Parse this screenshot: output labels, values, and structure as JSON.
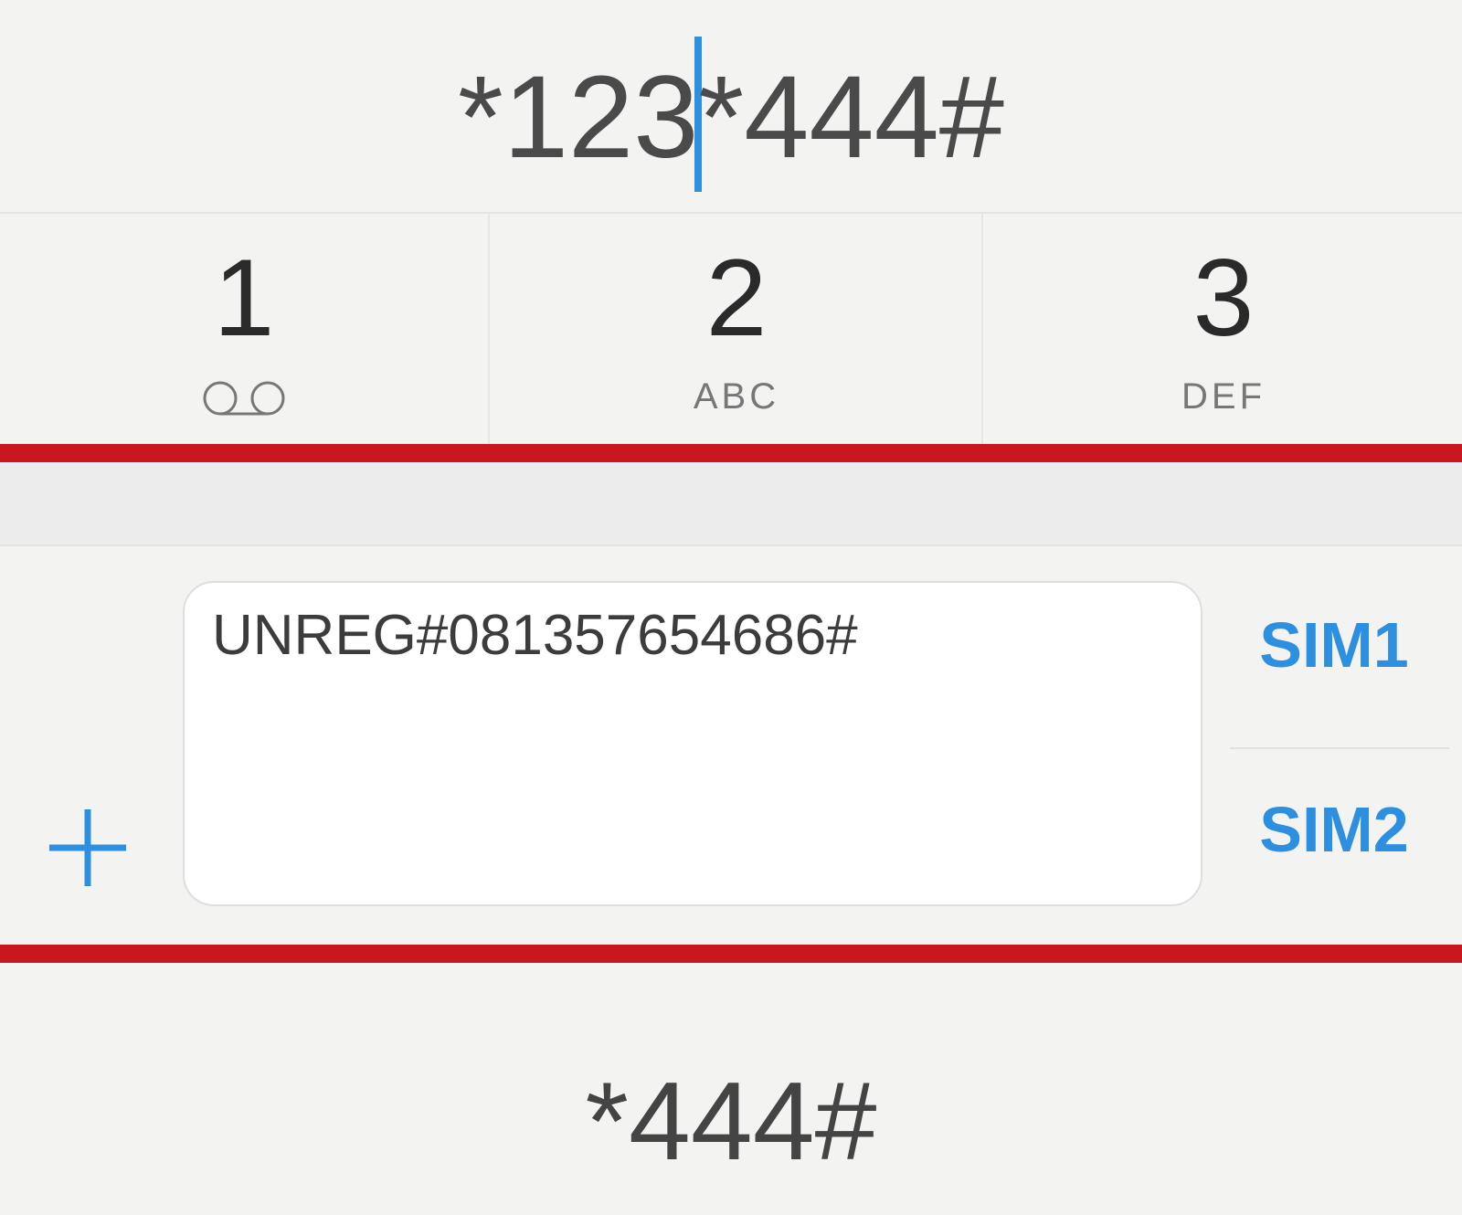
{
  "dialer": {
    "number_before_cursor": "*123",
    "number_after_cursor": "*444#"
  },
  "keypad": [
    {
      "digit": "1",
      "letters": "",
      "icon": "voicemail-icon"
    },
    {
      "digit": "2",
      "letters": "ABC"
    },
    {
      "digit": "3",
      "letters": "DEF"
    }
  ],
  "composer": {
    "message": "UNREG#081357654686#",
    "add_icon": "plus-icon",
    "sim1_label": "SIM1",
    "sim2_label": "SIM2"
  },
  "suggestion": {
    "code": "*444#"
  },
  "colors": {
    "accent": "#2d8fe0",
    "highlight": "#c8171f",
    "background": "#f3f4f2"
  }
}
